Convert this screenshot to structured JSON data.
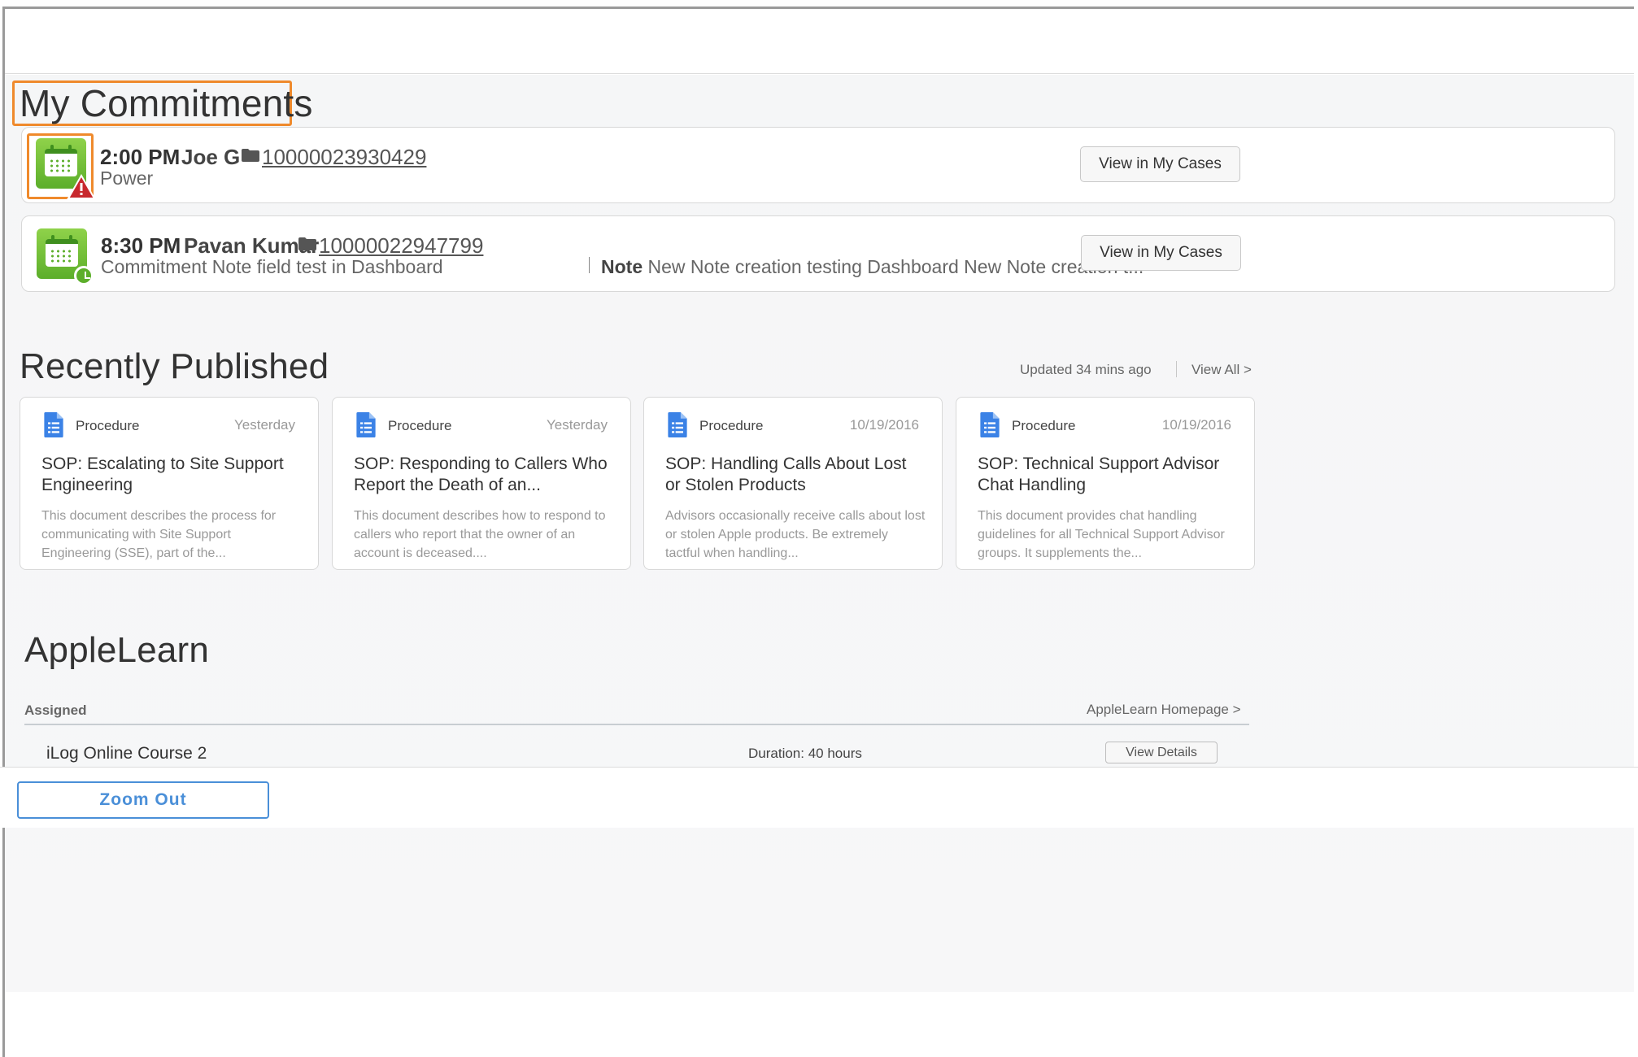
{
  "commitments": {
    "title": "My Commitments",
    "items": [
      {
        "time": "2:00 PM",
        "name": "Joe G",
        "case_number": "10000023930429",
        "subtitle": "Power",
        "status_icon": "warning-icon",
        "button_label": "View in My Cases"
      },
      {
        "time": "8:30 PM",
        "name": "Pavan Kumar",
        "case_number": "10000022947799",
        "subtitle": "Commitment Note field test in Dashboard",
        "note_label": "Note",
        "note_text": "New Note creation testing Dashboard New Note creation t...",
        "status_icon": "clock-icon",
        "button_label": "View in My Cases"
      }
    ]
  },
  "recently_published": {
    "title": "Recently Published",
    "updated": "Updated 34 mins ago",
    "view_all": "View All >",
    "cards": [
      {
        "type": "Procedure",
        "date": "Yesterday",
        "title": "SOP: Escalating to Site Support Engineering",
        "description": "This document describes the process for communicating with Site Support Engineering (SSE), part of the..."
      },
      {
        "type": "Procedure",
        "date": "Yesterday",
        "title": "SOP: Responding to Callers Who Report the Death of an...",
        "description": "This document describes how to respond to callers who report that the owner of an account is deceased...."
      },
      {
        "type": "Procedure",
        "date": "10/19/2016",
        "title": "SOP: Handling Calls About Lost or Stolen Products",
        "description": "Advisors occasionally receive calls about lost or stolen Apple products. Be extremely tactful when handling..."
      },
      {
        "type": "Procedure",
        "date": "10/19/2016",
        "title": "SOP: Technical Support Advisor Chat Handling",
        "description": "This document provides chat handling guidelines for all Technical Support Advisor groups. It supplements the..."
      }
    ]
  },
  "applelearn": {
    "title": "AppleLearn",
    "assigned_label": "Assigned",
    "homepage_link": "AppleLearn Homepage >",
    "course": {
      "name": "iLog Online Course 2",
      "duration": "Duration: 40 hours",
      "button_label": "View Details"
    }
  },
  "zoom_button": "Zoom Out",
  "colors": {
    "highlight": "#ef8a2c",
    "calendar_green": "#5cae2a",
    "warning_red": "#c8282d",
    "doc_blue": "#3b82e6",
    "zoom_blue": "#4a8fd8"
  }
}
